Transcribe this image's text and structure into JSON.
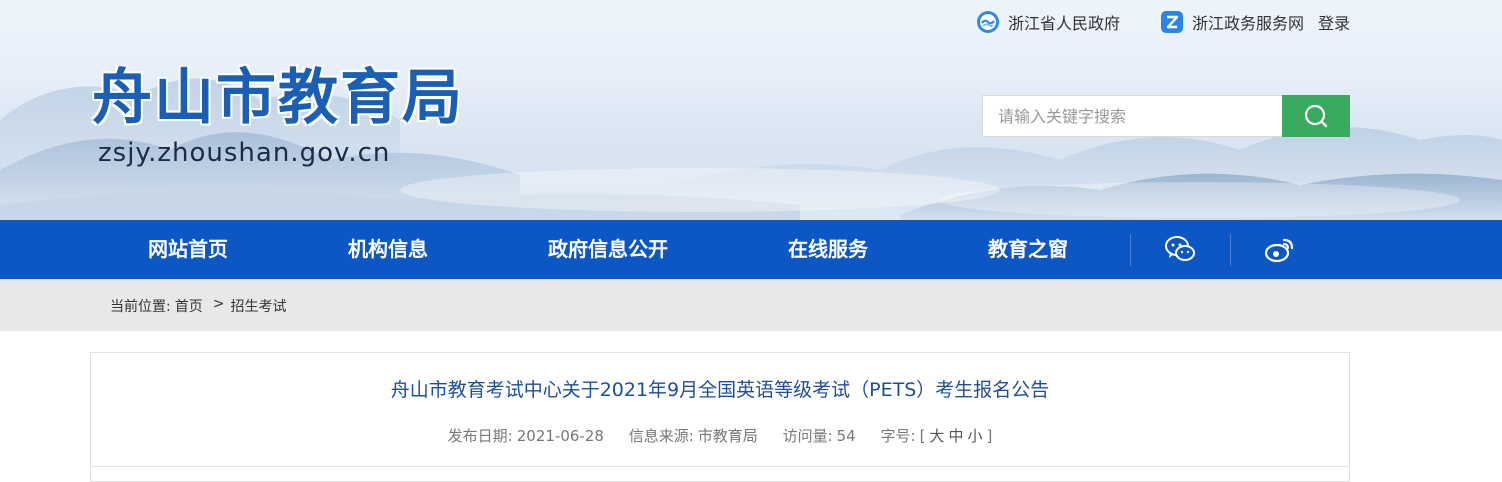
{
  "header": {
    "top_links": {
      "gov_label": "浙江省人民政府",
      "service_label": "浙江政务服务网",
      "login_label": "登录"
    },
    "logo_title": "舟山市教育局",
    "logo_domain": "zsjy.zhoushan.gov.cn",
    "search": {
      "placeholder": "请输入关键字搜索",
      "button_icon": "search-icon"
    }
  },
  "nav": {
    "items": [
      "网站首页",
      "机构信息",
      "政府信息公开",
      "在线服务",
      "教育之窗"
    ],
    "icons": [
      "wechat-icon",
      "weibo-icon"
    ]
  },
  "breadcrumb": {
    "prefix": "当前位置:",
    "home": "首页",
    "separator": ">",
    "current": "招生考试"
  },
  "article": {
    "title": "舟山市教育考试中心关于2021年9月全国英语等级考试（PETS）考生报名公告",
    "date_label": "发布日期:",
    "date": "2021-06-28",
    "source_label": "信息来源:",
    "source": "市教育局",
    "views_label": "访问量:",
    "views": "54",
    "fontsize_label": "字号:",
    "size_open": "[",
    "size_large": "大",
    "size_medium": "中",
    "size_small": "小",
    "size_close": "]"
  },
  "colors": {
    "nav_bg": "#0d57c5",
    "logo_blue": "#1a5fb4",
    "search_btn": "#3aaa5e",
    "title_blue": "#1d4f9a"
  }
}
